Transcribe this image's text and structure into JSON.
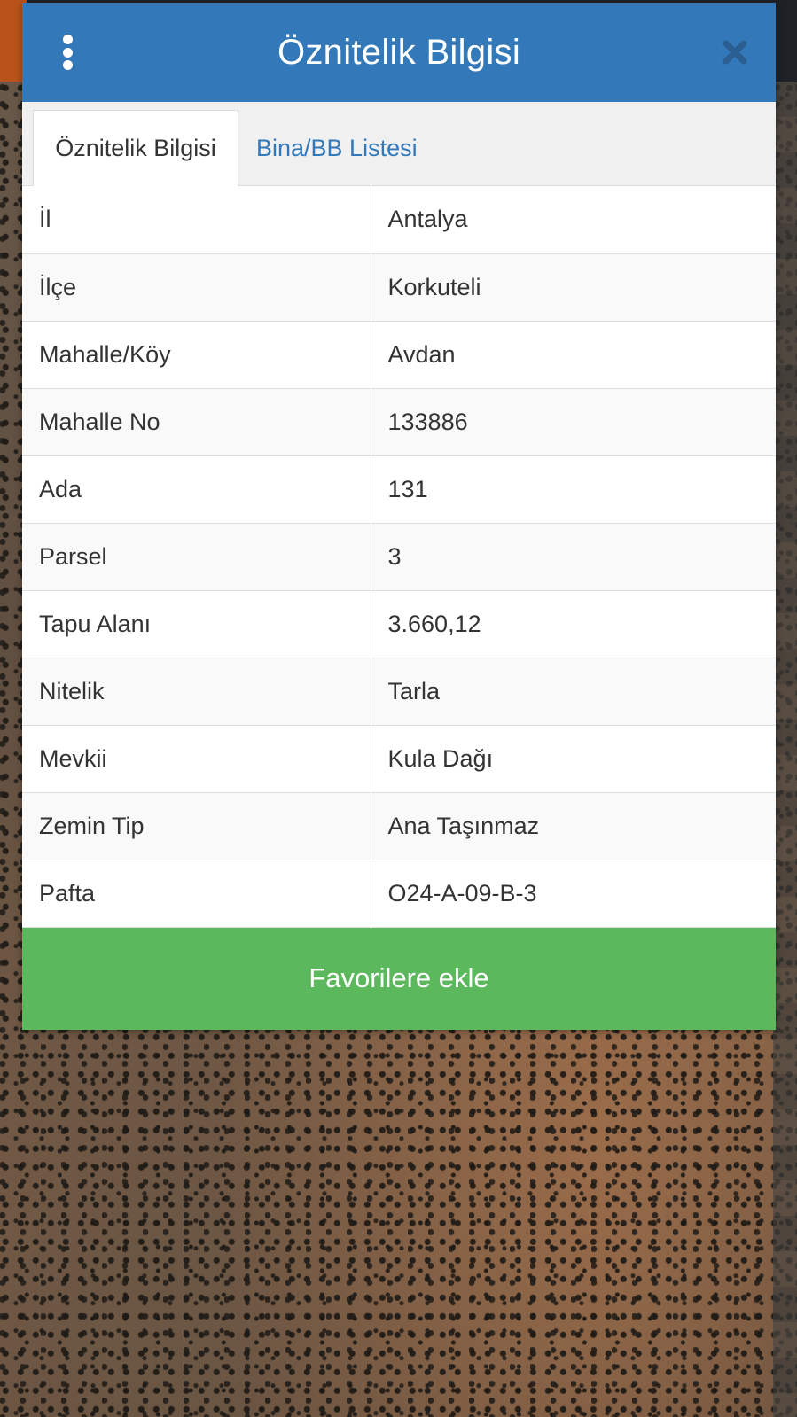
{
  "dialog": {
    "title": "Öznitelik Bilgisi",
    "menu_icon": "more-vertical-icon",
    "close_icon": "close-icon"
  },
  "tabs": [
    {
      "label": "Öznitelik Bilgisi",
      "active": true
    },
    {
      "label": "Bina/BB Listesi",
      "active": false
    }
  ],
  "attributes": [
    {
      "key": "İl",
      "value": "Antalya"
    },
    {
      "key": "İlçe",
      "value": "Korkuteli"
    },
    {
      "key": "Mahalle/Köy",
      "value": "Avdan"
    },
    {
      "key": "Mahalle No",
      "value": "133886"
    },
    {
      "key": "Ada",
      "value": "131"
    },
    {
      "key": "Parsel",
      "value": "3"
    },
    {
      "key": "Tapu Alanı",
      "value": "3.660,12"
    },
    {
      "key": "Nitelik",
      "value": "Tarla"
    },
    {
      "key": "Mevkii",
      "value": "Kula Dağı"
    },
    {
      "key": "Zemin Tip",
      "value": "Ana Taşınmaz"
    },
    {
      "key": "Pafta",
      "value": "O24-A-09-B-3"
    }
  ],
  "favorite_button": {
    "label": "Favorilere ekle"
  },
  "colors": {
    "header": "#3378b8",
    "tab_link": "#3378b8",
    "favorite_button": "#5cb85c"
  }
}
